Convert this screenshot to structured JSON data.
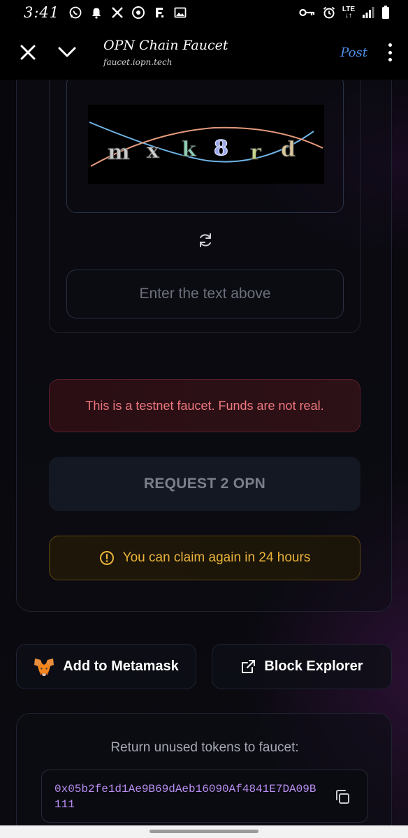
{
  "status_bar": {
    "time": "3:41",
    "network": "LTE",
    "left_icons": [
      "whatsapp-icon",
      "notification-bell-icon",
      "x-app-icon",
      "chrome-icon",
      "f-app-icon",
      "gallery-icon"
    ],
    "right_icons": [
      "key-icon",
      "alarm-icon",
      "lte-icon",
      "signal-icon",
      "battery-icon"
    ]
  },
  "header": {
    "title": "OPN Chain Faucet",
    "url": "faucet.iopn.tech",
    "post_label": "Post"
  },
  "captcha": {
    "text": "mxk8rd",
    "characters": [
      "m",
      "x",
      "k",
      "8",
      "r",
      "d"
    ],
    "input_placeholder": "Enter the text above",
    "input_value": ""
  },
  "warning": {
    "text": "This is a testnet faucet. Funds are not real."
  },
  "request_button": {
    "label": "REQUEST 2 OPN"
  },
  "claim_notice": {
    "text": "You can claim again in 24 hours"
  },
  "actions": {
    "metamask_label": "Add to Metamask",
    "explorer_label": "Block Explorer"
  },
  "return_section": {
    "label": "Return unused tokens to faucet:",
    "address": "0x05b2fe1d1Ae9B69dAeb16090Af4841E7DA09B111"
  },
  "colors": {
    "warning_text": "#f0797e",
    "claim_text": "#eab43a",
    "address_text": "#b98ef0",
    "post_link": "#4f8fe8"
  }
}
